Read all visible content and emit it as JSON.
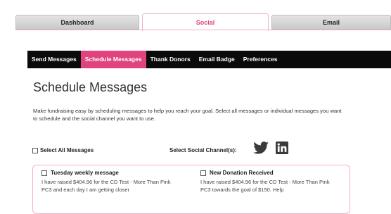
{
  "top_tabs": [
    {
      "label": "Dashboard"
    },
    {
      "label": "Social"
    },
    {
      "label": "Email"
    }
  ],
  "subnav": [
    {
      "label": "Send Messages"
    },
    {
      "label": "Schedule Messages"
    },
    {
      "label": "Thank Donors"
    },
    {
      "label": "Email Badge"
    },
    {
      "label": "Preferences"
    }
  ],
  "page_title": "Schedule Messages",
  "intro_text": "Make fundraising easy by scheduling messages to help you reach your goal. Select all messages or individual messages you want to schedule and the social channel you want to use.",
  "select_all_label": "Select All Messages",
  "select_channel_label": "Select Social Channel(s):",
  "social_icons": [
    "twitter-icon",
    "linkedin-icon"
  ],
  "messages": [
    {
      "title": "Tuesday weekly message",
      "body": "I have raised $404.96 for the CD Test - More Than Pink PC3 and each day I am getting closer"
    },
    {
      "title": "New Donation Received",
      "body": "I have raised $404.96 for the CD Test - More Than Pink PC3 towards the goal of $150. Help"
    }
  ],
  "colors": {
    "accent": "#e0437e",
    "subnav_bg": "#0a0a0a",
    "tab_bg": "#d4d4d4",
    "card_border": "#f2b0c9"
  }
}
